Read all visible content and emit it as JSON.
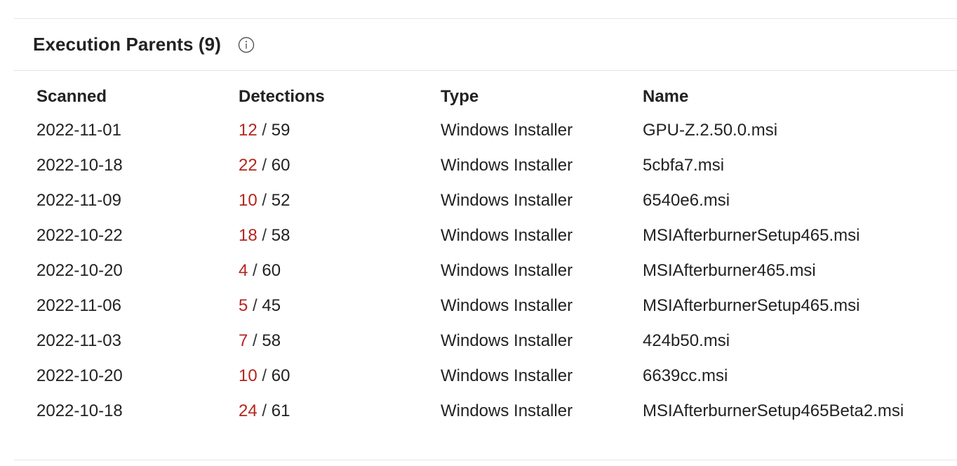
{
  "section": {
    "title": "Execution Parents (9)",
    "info_icon": "info-circle-icon"
  },
  "table": {
    "headers": {
      "scanned": "Scanned",
      "detections": "Detections",
      "type": "Type",
      "name": "Name"
    },
    "rows": [
      {
        "scanned": "2022-11-01",
        "detections_positive": "12",
        "detections_sep": " / ",
        "detections_total": "59",
        "type": "Windows Installer",
        "name": "GPU-Z.2.50.0.msi"
      },
      {
        "scanned": "2022-10-18",
        "detections_positive": "22",
        "detections_sep": " / ",
        "detections_total": "60",
        "type": "Windows Installer",
        "name": "5cbfa7.msi"
      },
      {
        "scanned": "2022-11-09",
        "detections_positive": "10",
        "detections_sep": " / ",
        "detections_total": "52",
        "type": "Windows Installer",
        "name": "6540e6.msi"
      },
      {
        "scanned": "2022-10-22",
        "detections_positive": "18",
        "detections_sep": " / ",
        "detections_total": "58",
        "type": "Windows Installer",
        "name": "MSIAfterburnerSetup465.msi"
      },
      {
        "scanned": "2022-10-20",
        "detections_positive": "4",
        "detections_sep": " / ",
        "detections_total": "60",
        "type": "Windows Installer",
        "name": "MSIAfterburner465.msi"
      },
      {
        "scanned": "2022-11-06",
        "detections_positive": "5",
        "detections_sep": " / ",
        "detections_total": "45",
        "type": "Windows Installer",
        "name": "MSIAfterburnerSetup465.msi"
      },
      {
        "scanned": "2022-11-03",
        "detections_positive": "7",
        "detections_sep": " / ",
        "detections_total": "58",
        "type": "Windows Installer",
        "name": "424b50.msi"
      },
      {
        "scanned": "2022-10-20",
        "detections_positive": "10",
        "detections_sep": " / ",
        "detections_total": "60",
        "type": "Windows Installer",
        "name": "6639cc.msi"
      },
      {
        "scanned": "2022-10-18",
        "detections_positive": "24",
        "detections_sep": " / ",
        "detections_total": "61",
        "type": "Windows Installer",
        "name": "MSIAfterburnerSetup465Beta2.msi"
      }
    ]
  },
  "colors": {
    "positive_detections": "#b3261e",
    "text": "#222222",
    "divider": "#e2e2e2"
  }
}
